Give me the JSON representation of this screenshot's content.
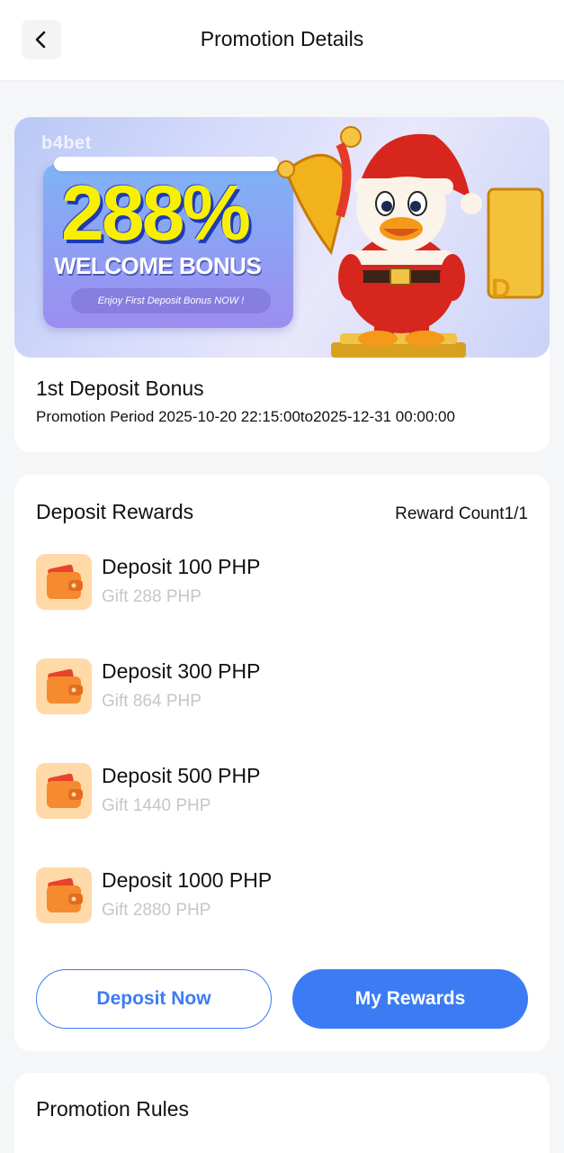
{
  "header": {
    "title": "Promotion Details"
  },
  "banner": {
    "brand": "b4bet",
    "headline": "288%",
    "subheadline": "WELCOME BONUS",
    "tagline": "Enjoy First Deposit Bonus NOW !"
  },
  "promotion": {
    "title": "1st Deposit Bonus",
    "period": "Promotion Period 2025-10-20 22:15:00to2025-12-31 00:00:00"
  },
  "rewards": {
    "title": "Deposit Rewards",
    "count": "Reward Count1/1",
    "items": [
      {
        "deposit": "Deposit 100 PHP",
        "gift": "Gift 288 PHP"
      },
      {
        "deposit": "Deposit 300 PHP",
        "gift": "Gift 864 PHP"
      },
      {
        "deposit": "Deposit 500 PHP",
        "gift": "Gift 1440 PHP"
      },
      {
        "deposit": "Deposit 1000 PHP",
        "gift": "Gift 2880 PHP"
      }
    ],
    "deposit_button": "Deposit Now",
    "rewards_button": "My Rewards"
  },
  "rules": {
    "title": "Promotion Rules"
  },
  "colors": {
    "accent": "#3b7cf4",
    "muted": "#c6c6c6",
    "background": "#f5f6f8"
  },
  "icons": {
    "back": "chevron-left-icon",
    "reward": "wallet-icon"
  }
}
